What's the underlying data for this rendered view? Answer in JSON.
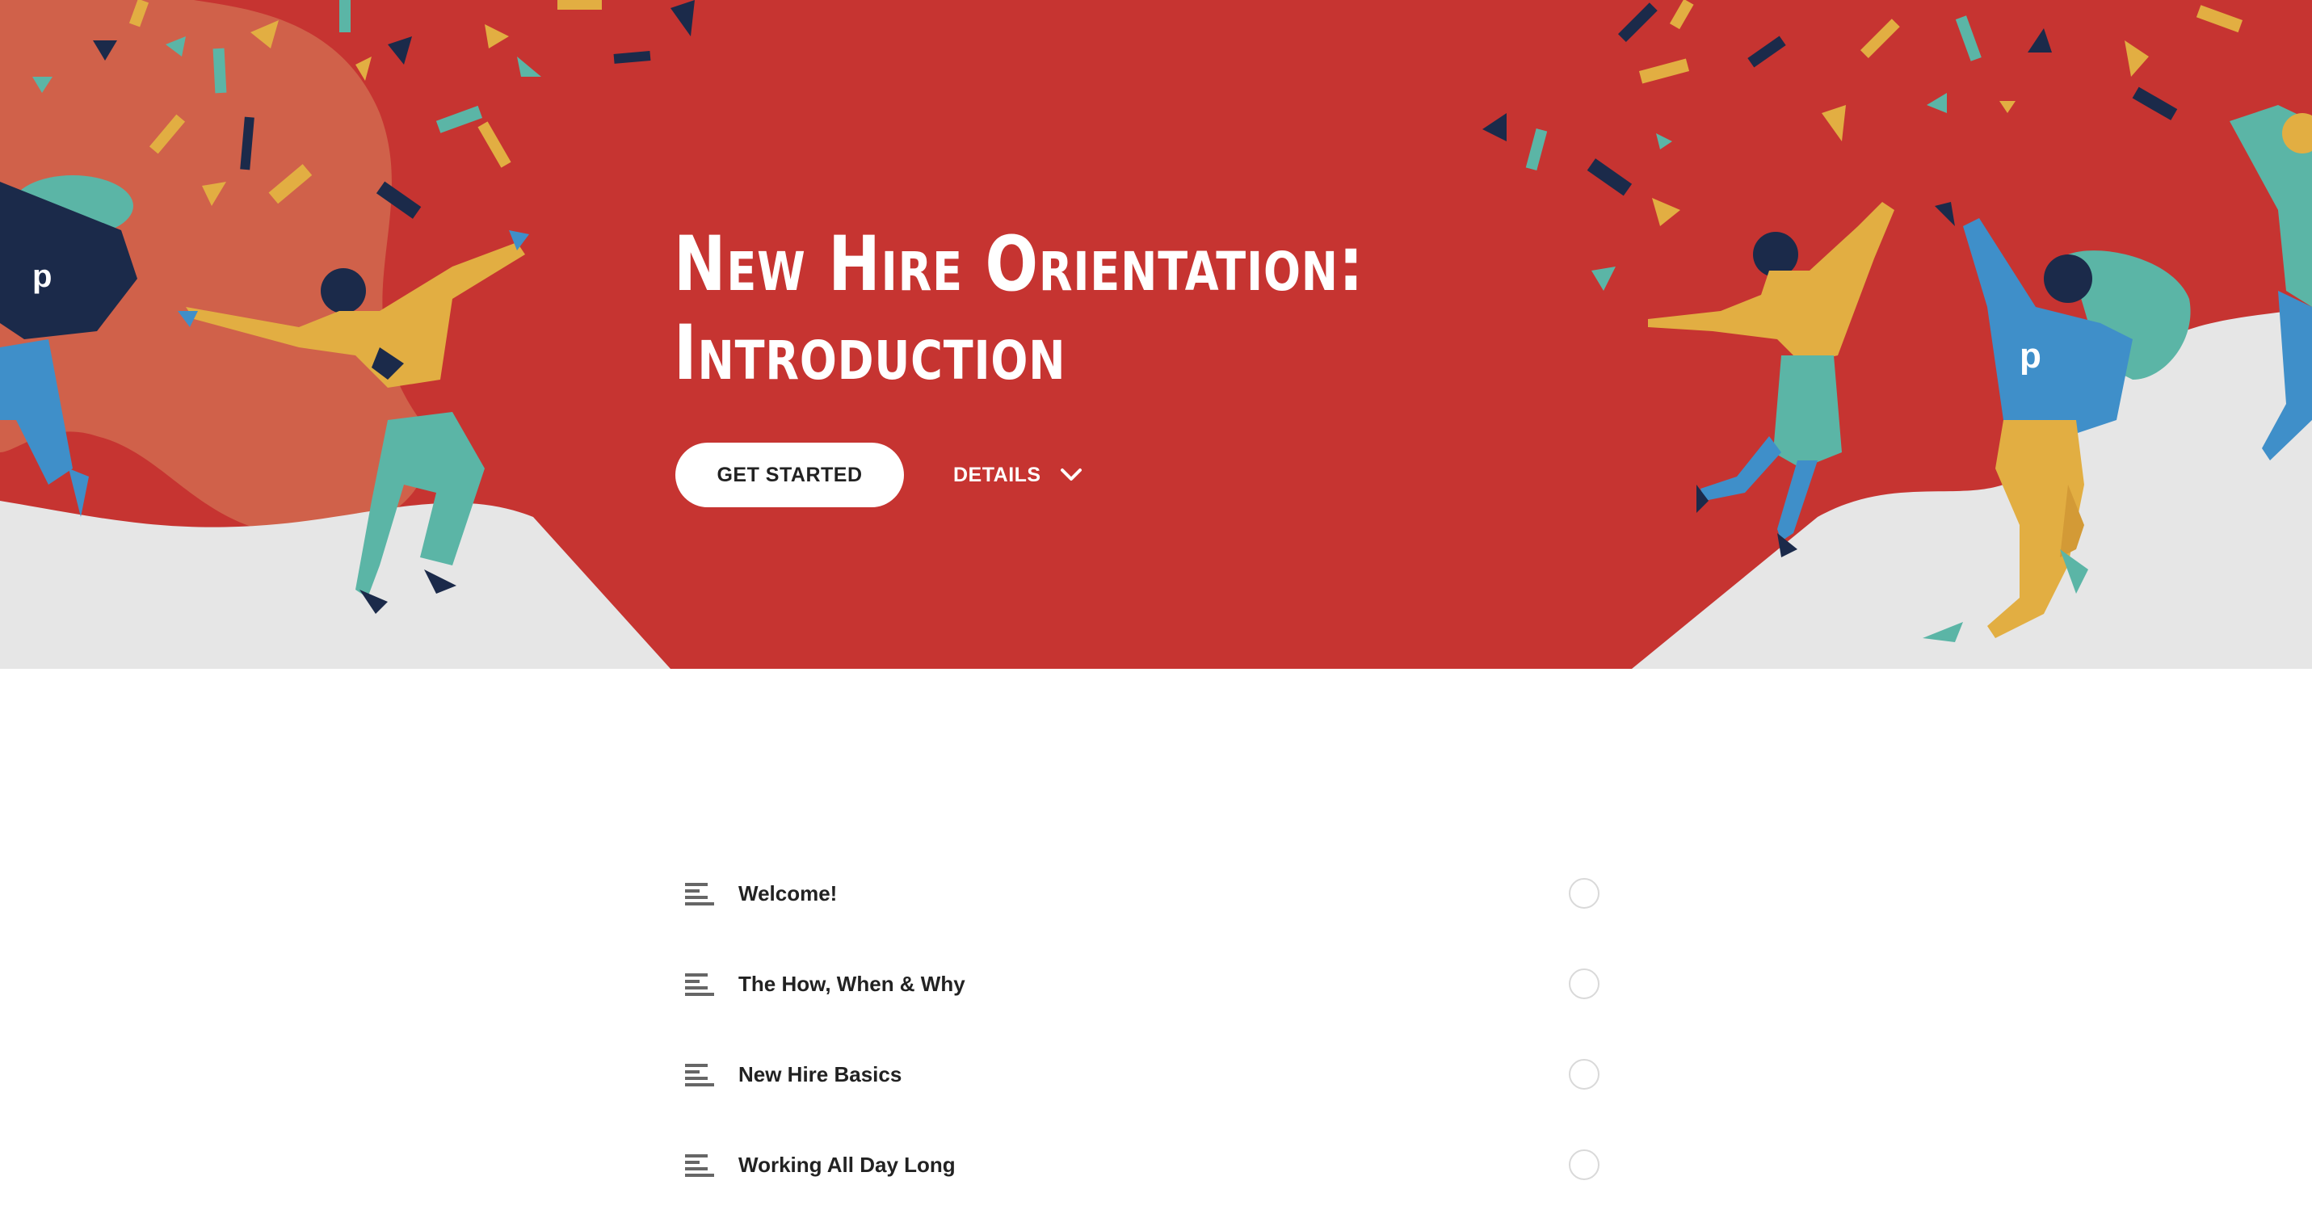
{
  "hero": {
    "title_line1": "New Hire Orientation:",
    "title_line2": "Introduction",
    "background_color": "#c63431"
  },
  "actions": {
    "get_started_label": "GET STARTED",
    "details_label": "DETAILS",
    "details_icon": "chevron-down-icon"
  },
  "lessons": [
    {
      "label": "Welcome!",
      "icon": "text-lines-icon",
      "completed": false
    },
    {
      "label": "The How, When & Why",
      "icon": "text-lines-icon",
      "completed": false
    },
    {
      "label": "New Hire Basics",
      "icon": "text-lines-icon",
      "completed": false
    },
    {
      "label": "Working All Day Long",
      "icon": "text-lines-icon",
      "completed": false
    }
  ]
}
